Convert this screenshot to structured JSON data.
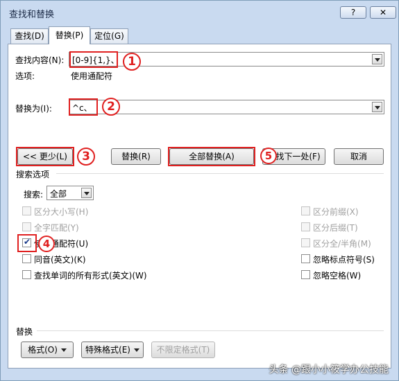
{
  "window": {
    "title": "查找和替换",
    "help_btn": "?",
    "close_btn": "✕"
  },
  "tabs": [
    {
      "label": "查找(D)"
    },
    {
      "label": "替换(P)"
    },
    {
      "label": "定位(G)"
    }
  ],
  "find": {
    "label": "查找内容(N):",
    "value": "[0-9]{1,}、",
    "options_label": "选项:",
    "options_value": "使用通配符"
  },
  "replace": {
    "label": "替换为(I):",
    "value": "^c、"
  },
  "buttons": {
    "less": "<< 更少(L)",
    "replace": "替换(R)",
    "replace_all": "全部替换(A)",
    "find_next": "查找下一处(F)",
    "cancel": "取消"
  },
  "search_options": {
    "section_label": "搜索选项",
    "search_label": "搜索:",
    "search_value": "全部",
    "left": [
      {
        "label": "区分大小写(H)",
        "checked": false,
        "disabled": true
      },
      {
        "label": "全字匹配(Y)",
        "checked": false,
        "disabled": true
      },
      {
        "label": "使用通配符(U)",
        "checked": true,
        "disabled": false
      },
      {
        "label": "同音(英文)(K)",
        "checked": false,
        "disabled": false
      },
      {
        "label": "查找单词的所有形式(英文)(W)",
        "checked": false,
        "disabled": false
      }
    ],
    "right": [
      {
        "label": "区分前缀(X)",
        "checked": false,
        "disabled": true
      },
      {
        "label": "区分后缀(T)",
        "checked": false,
        "disabled": true
      },
      {
        "label": "区分全/半角(M)",
        "checked": false,
        "disabled": true
      },
      {
        "label": "忽略标点符号(S)",
        "checked": false,
        "disabled": false
      },
      {
        "label": "忽略空格(W)",
        "checked": false,
        "disabled": false
      }
    ]
  },
  "replace_section": {
    "label": "替换",
    "format_btn": "格式(O)",
    "special_btn": "特殊格式(E)",
    "noformat_btn": "不限定格式(T)"
  },
  "annotations": [
    "1",
    "2",
    "3",
    "4",
    "5"
  ],
  "watermark": "头条 @跟小小筱学办公技能"
}
